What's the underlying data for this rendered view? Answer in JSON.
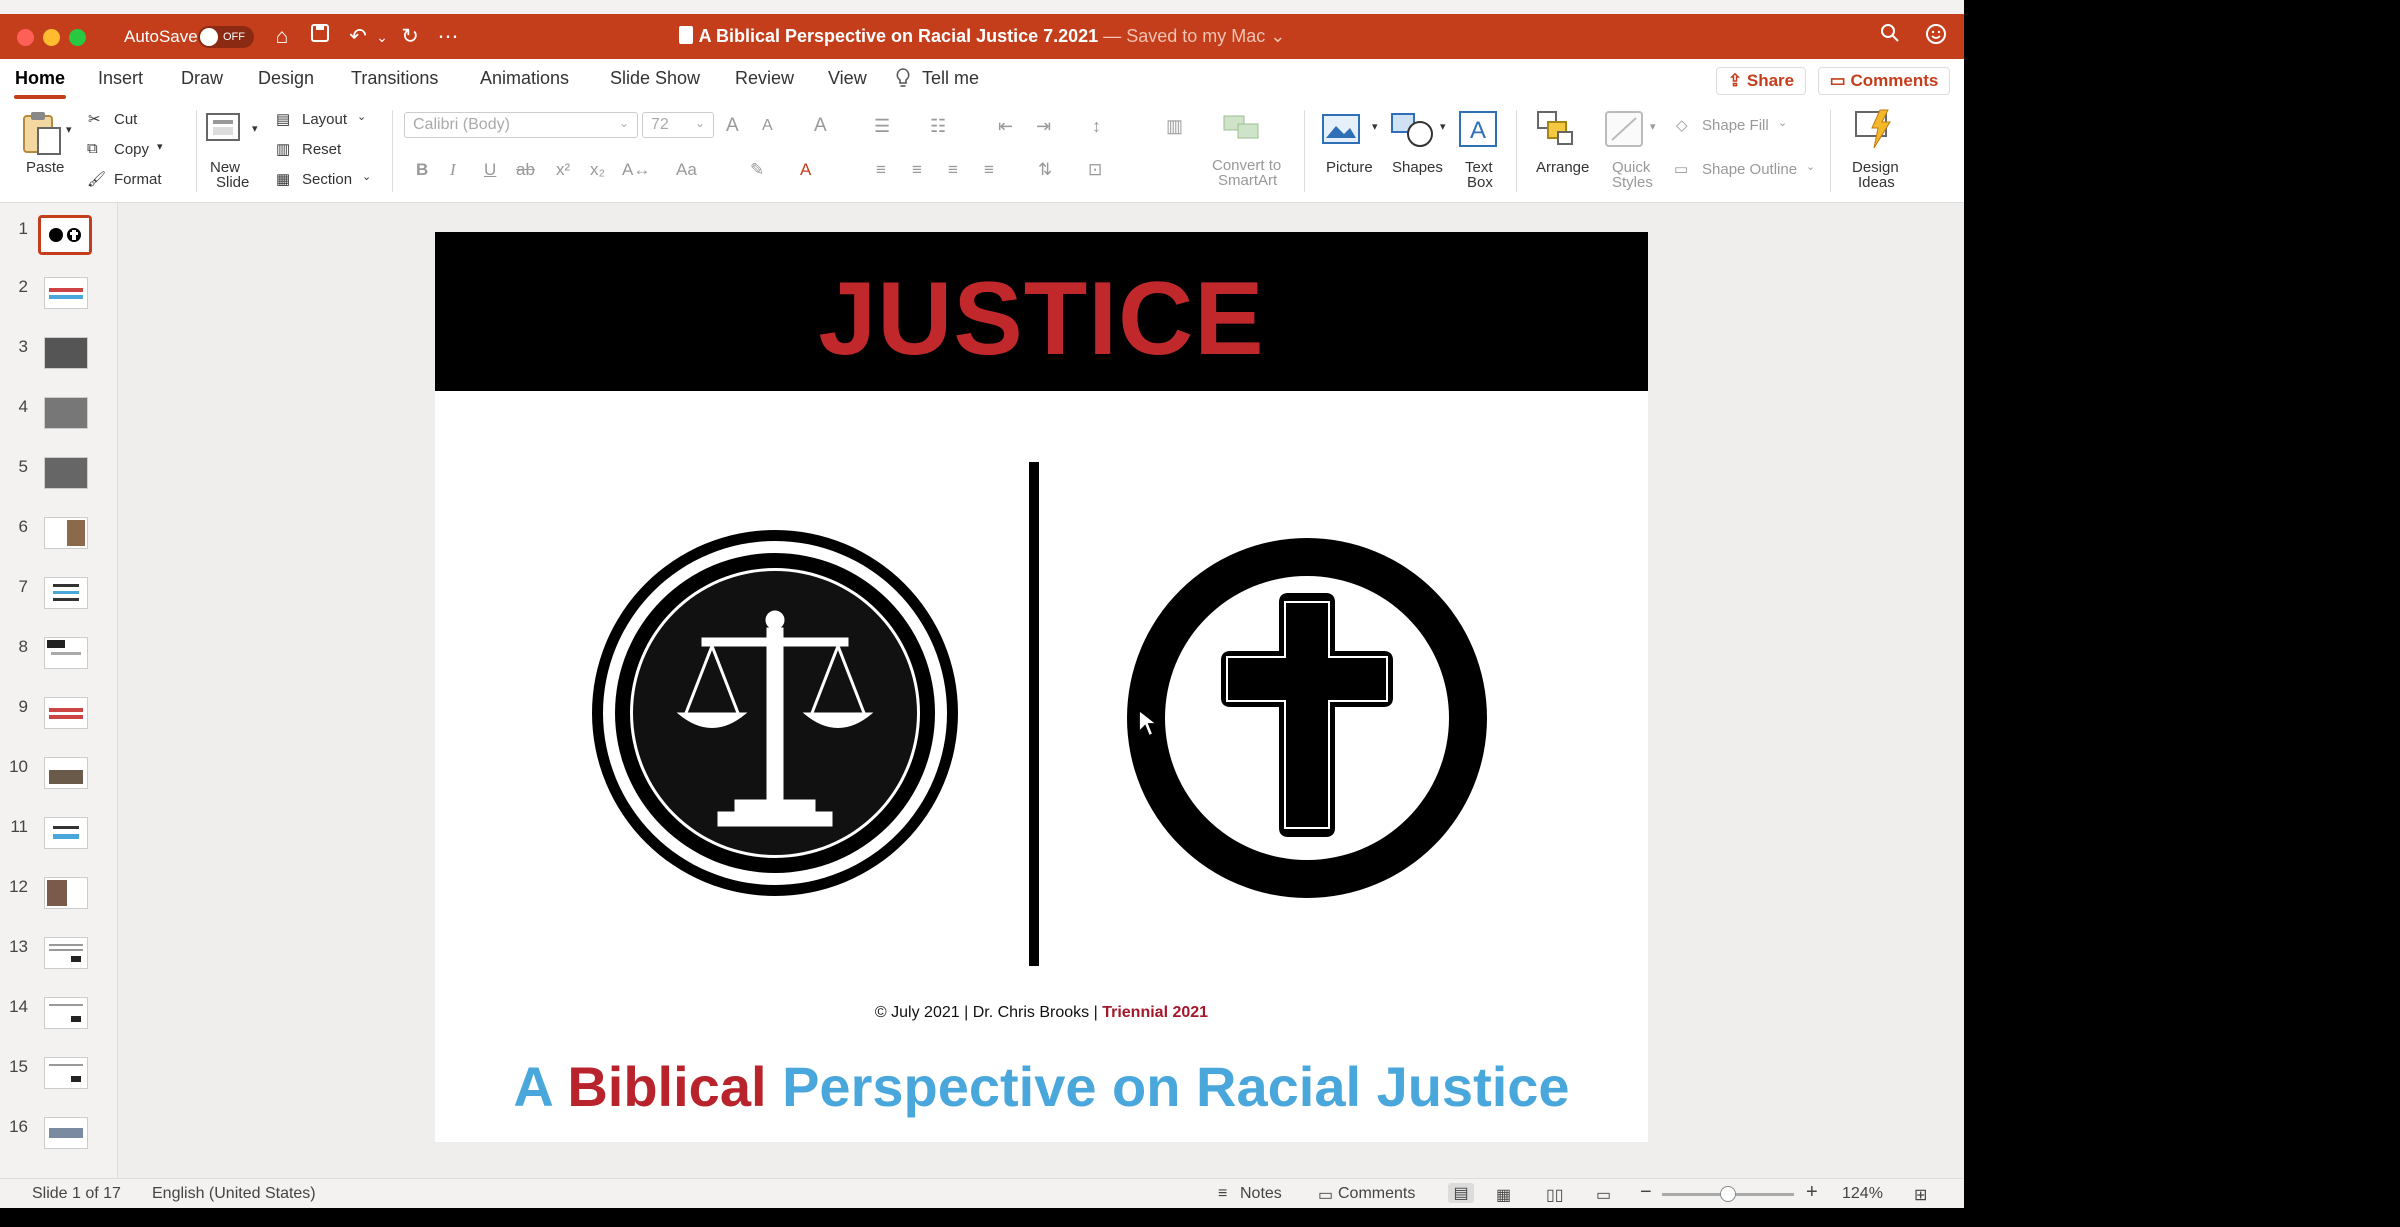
{
  "titlebar": {
    "autosave_label": "AutoSave",
    "autosave_state": "OFF",
    "doc_title": "A Biblical Perspective on Racial Justice 7.2021",
    "saved_status": "— Saved to my Mac ⌄"
  },
  "tabs": [
    "Home",
    "Insert",
    "Draw",
    "Design",
    "Transitions",
    "Animations",
    "Slide Show",
    "Review",
    "View",
    "Tell me"
  ],
  "share_label": "Share",
  "comments_label": "Comments",
  "ribbon": {
    "paste": "Paste",
    "cut": "Cut",
    "copy": "Copy",
    "format": "Format",
    "new_slide_1": "New",
    "new_slide_2": "Slide",
    "layout": "Layout",
    "reset": "Reset",
    "section": "Section",
    "font_name": "Calibri (Body)",
    "font_size": "72",
    "convert_1": "Convert to",
    "convert_2": "SmartArt",
    "picture": "Picture",
    "shapes": "Shapes",
    "textbox_1": "Text",
    "textbox_2": "Box",
    "arrange": "Arrange",
    "quick_1": "Quick",
    "quick_2": "Styles",
    "shape_fill": "Shape Fill",
    "shape_outline": "Shape Outline",
    "design_1": "Design",
    "design_2": "Ideas"
  },
  "thumbnails": [
    "1",
    "2",
    "3",
    "4",
    "5",
    "6",
    "7",
    "8",
    "9",
    "10",
    "11",
    "12",
    "13",
    "14",
    "15",
    "16"
  ],
  "slide": {
    "title": "JUSTICE",
    "credit": "© July 2021 | Dr. Chris Brooks | ",
    "credit_red": "Triennial 2021",
    "subtitle_a": "A ",
    "subtitle_red": "Biblical",
    "subtitle_rest": " Perspective on Racial Justice"
  },
  "status": {
    "slide_pos": "Slide 1 of 17",
    "language": "English (United States)",
    "notes": "Notes",
    "comments": "Comments",
    "zoom": "124%",
    "zoom_level": 0.5
  },
  "colors": {
    "brand": "#c43e1c",
    "title_red": "#c0282b",
    "subtitle_blue": "#4aa7dc"
  }
}
